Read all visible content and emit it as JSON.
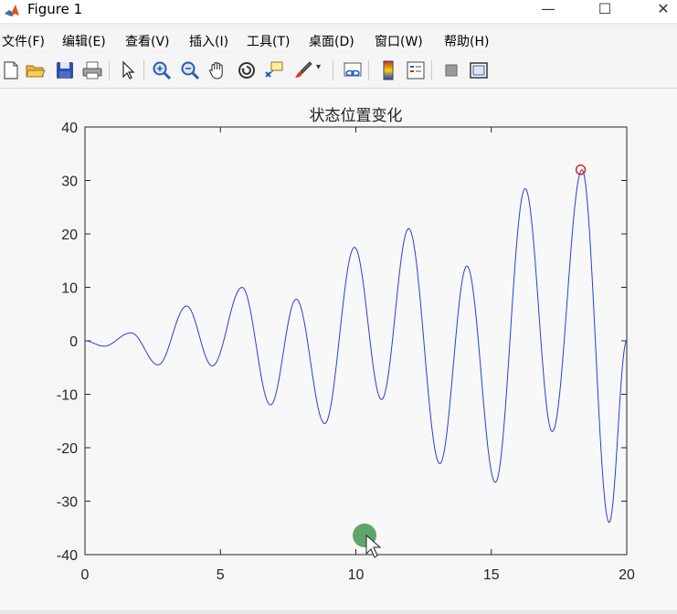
{
  "window": {
    "title": "Figure 1",
    "minimize": "—",
    "maximize": "☐",
    "close": "✕"
  },
  "menu": [
    "文件(F)",
    "编辑(E)",
    "查看(V)",
    "插入(I)",
    "工具(T)",
    "桌面(D)",
    "窗口(W)",
    "帮助(H)"
  ],
  "toolbar_icons": [
    "new-figure-icon",
    "open-file-icon",
    "save-icon",
    "print-icon",
    "pointer-icon",
    "zoom-in-icon",
    "zoom-out-icon",
    "pan-hand-icon",
    "rotate-3d-icon",
    "data-cursor-icon",
    "brush-icon",
    "link-plot-icon",
    "colorbar-icon",
    "legend-icon",
    "hide-plot-tools-icon",
    "show-plot-tools-icon"
  ],
  "colors": {
    "line": "#2b3fd6",
    "marker": "#e02020",
    "cursor_dot": "#4f9a5a",
    "axes_bg": "#f8f8f8"
  },
  "chart_data": {
    "type": "line",
    "title": "状态位置变化",
    "xlim": [
      0,
      20
    ],
    "ylim": [
      -40,
      40
    ],
    "x_ticks": [
      "0",
      "5",
      "10",
      "15",
      "20"
    ],
    "y_ticks": [
      "-40",
      "-30",
      "-20",
      "-10",
      "0",
      "10",
      "20",
      "30",
      "40"
    ],
    "xlabel": "",
    "ylabel": "",
    "grid": false,
    "series": [
      {
        "x": [
          0,
          0.7,
          1.7,
          2.7,
          3.75,
          4.7,
          5.8,
          6.85,
          7.8,
          8.85,
          9.95,
          10.95,
          11.95,
          13.1,
          14.1,
          15.15,
          16.25,
          17.25,
          18.35,
          19.35,
          20.0
        ],
        "y": [
          0,
          -1,
          1.5,
          -4.5,
          6.5,
          -4.7,
          10,
          -12,
          7.8,
          -15.5,
          17.5,
          -11,
          21,
          -23,
          14,
          -26.5,
          28.5,
          -17,
          32,
          -34,
          0
        ]
      }
    ],
    "marker": {
      "x": 18.3,
      "y": 32
    }
  }
}
